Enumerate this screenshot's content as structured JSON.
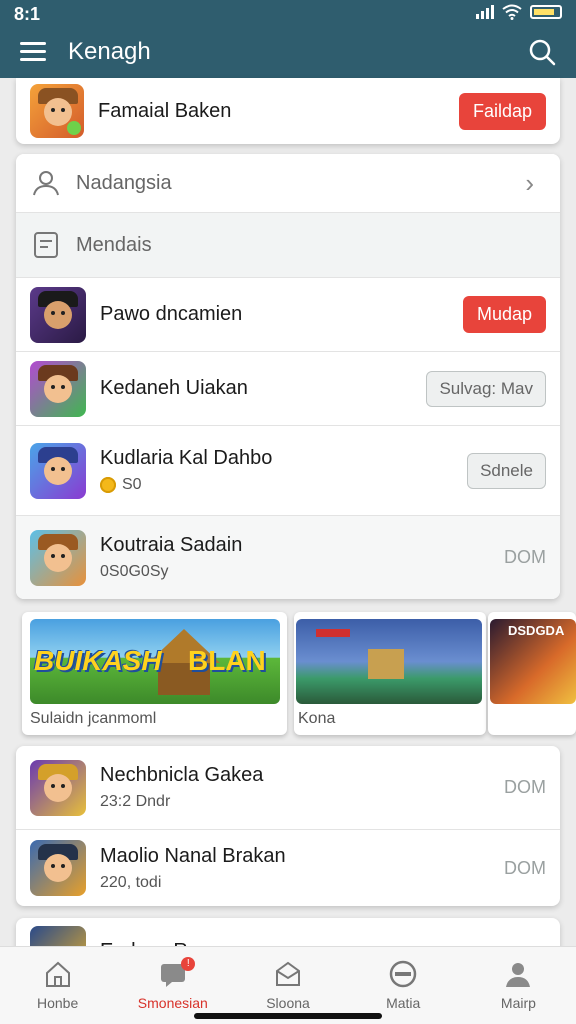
{
  "status_bar": {
    "time": "8:1"
  },
  "header": {
    "title": "Kenagh"
  },
  "top_item": {
    "title": "Famaial Baken",
    "button": "Faildap"
  },
  "menu": {
    "rows": [
      {
        "label": "Nadangsia"
      },
      {
        "label": "Mendais"
      }
    ]
  },
  "list1": [
    {
      "title": "Pawo dncamien",
      "sub": "",
      "button": "Mudap",
      "button_style": "red"
    },
    {
      "title": "Kedaneh Uiakan",
      "sub": "",
      "button": "Sulvag: Mav",
      "button_style": "gray"
    },
    {
      "title": "Kudlaria Kal Dahbo",
      "sub": "S0",
      "button": "Sdnele",
      "button_style": "gray"
    },
    {
      "title": "Koutraia Sadain",
      "sub": "0S0G0Sy",
      "button": "DOM",
      "button_style": "ghost"
    }
  ],
  "banners": [
    {
      "title_left": "BUIKASH",
      "title_right": "BLAN",
      "caption": "Sulaidn jcanmoml"
    },
    {
      "caption": "Kona"
    },
    {
      "title": "DSDGDA"
    }
  ],
  "list2": [
    {
      "title": "Nechbnicla Gakea",
      "sub": "23:2 Dndr",
      "button": "DOM"
    },
    {
      "title": "Maolio Nanal Brakan",
      "sub": "220, todi",
      "button": "DOM"
    }
  ],
  "partial_item": {
    "title": "Eaduas Ra"
  },
  "bottom_nav": [
    {
      "label": "Honbe",
      "active": false
    },
    {
      "label": "Smonesian",
      "active": true,
      "badge": "!"
    },
    {
      "label": "Sloona",
      "active": false
    },
    {
      "label": "Matia",
      "active": false
    },
    {
      "label": "Mairp",
      "active": false
    }
  ],
  "colors": {
    "header": "#2f5d6e",
    "accent_red": "#e8443b"
  }
}
